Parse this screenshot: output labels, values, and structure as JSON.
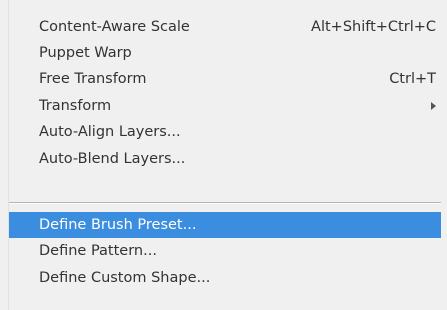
{
  "menu": {
    "items": [
      {
        "label": "Content-Aware Scale",
        "shortcut": "Alt+Shift+Ctrl+C"
      },
      {
        "label": "Puppet Warp",
        "shortcut": ""
      },
      {
        "label": "Free Transform",
        "shortcut": "Ctrl+T"
      },
      {
        "label": "Transform",
        "shortcut": "",
        "submenu_icon": "chevron-right-icon"
      },
      {
        "label": "Auto-Align Layers...",
        "shortcut": ""
      },
      {
        "label": "Auto-Blend Layers...",
        "shortcut": ""
      },
      {
        "label": "Define Brush Preset...",
        "shortcut": "",
        "highlighted": true
      },
      {
        "label": "Define Pattern...",
        "shortcut": ""
      },
      {
        "label": "Define Custom Shape...",
        "shortcut": ""
      }
    ],
    "colors": {
      "background": "#f0f0f0",
      "highlight": "#3b8ddf",
      "text": "#333333",
      "highlight_text": "#ffffff"
    }
  }
}
